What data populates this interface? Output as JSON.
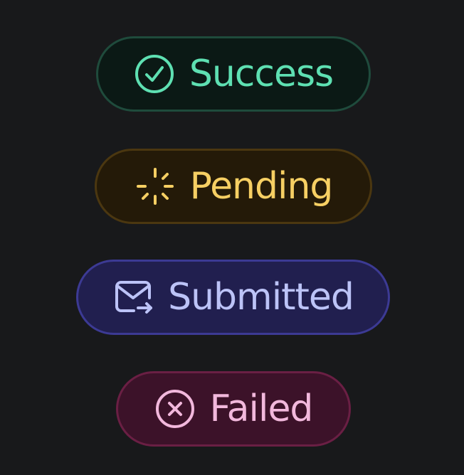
{
  "badges": {
    "success": {
      "label": "Success",
      "icon": "check-circle-icon",
      "text_color": "#5ee0b2",
      "bg_color": "#0b1915",
      "border_color": "#1f4b3c"
    },
    "pending": {
      "label": "Pending",
      "icon": "loader-spinner-icon",
      "text_color": "#f6cf63",
      "bg_color": "#241a08",
      "border_color": "#4b3710"
    },
    "submitted": {
      "label": "Submitted",
      "icon": "mail-forward-icon",
      "text_color": "#bcc3f7",
      "bg_color": "#211f4f",
      "border_color": "#3c3a94"
    },
    "failed": {
      "label": "Failed",
      "icon": "x-circle-icon",
      "text_color": "#f2b8dc",
      "bg_color": "#3c1229",
      "border_color": "#6a1f44"
    }
  },
  "background": "#18191b"
}
